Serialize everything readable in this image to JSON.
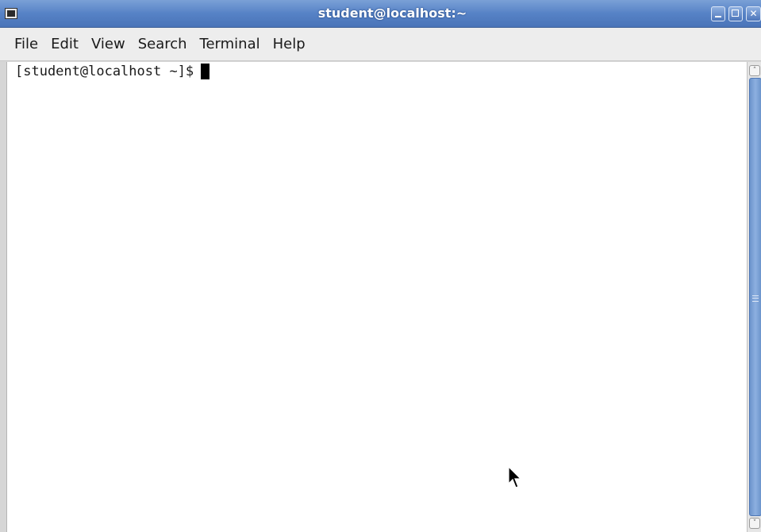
{
  "window": {
    "title": "student@localhost:~",
    "app_icon": "terminal-icon",
    "controls": [
      "minimize-icon",
      "maximize-icon",
      "close-icon"
    ]
  },
  "menubar": {
    "items": [
      {
        "label": "File"
      },
      {
        "label": "Edit"
      },
      {
        "label": "View"
      },
      {
        "label": "Search"
      },
      {
        "label": "Terminal"
      },
      {
        "label": "Help"
      }
    ]
  },
  "terminal": {
    "prompt": "[student@localhost ~]$"
  },
  "colors": {
    "titlebar": "#5682c6",
    "terminal_bg": "#ffffff",
    "text": "#1a1a1a",
    "scroll_thumb": "#7ca2d8"
  }
}
